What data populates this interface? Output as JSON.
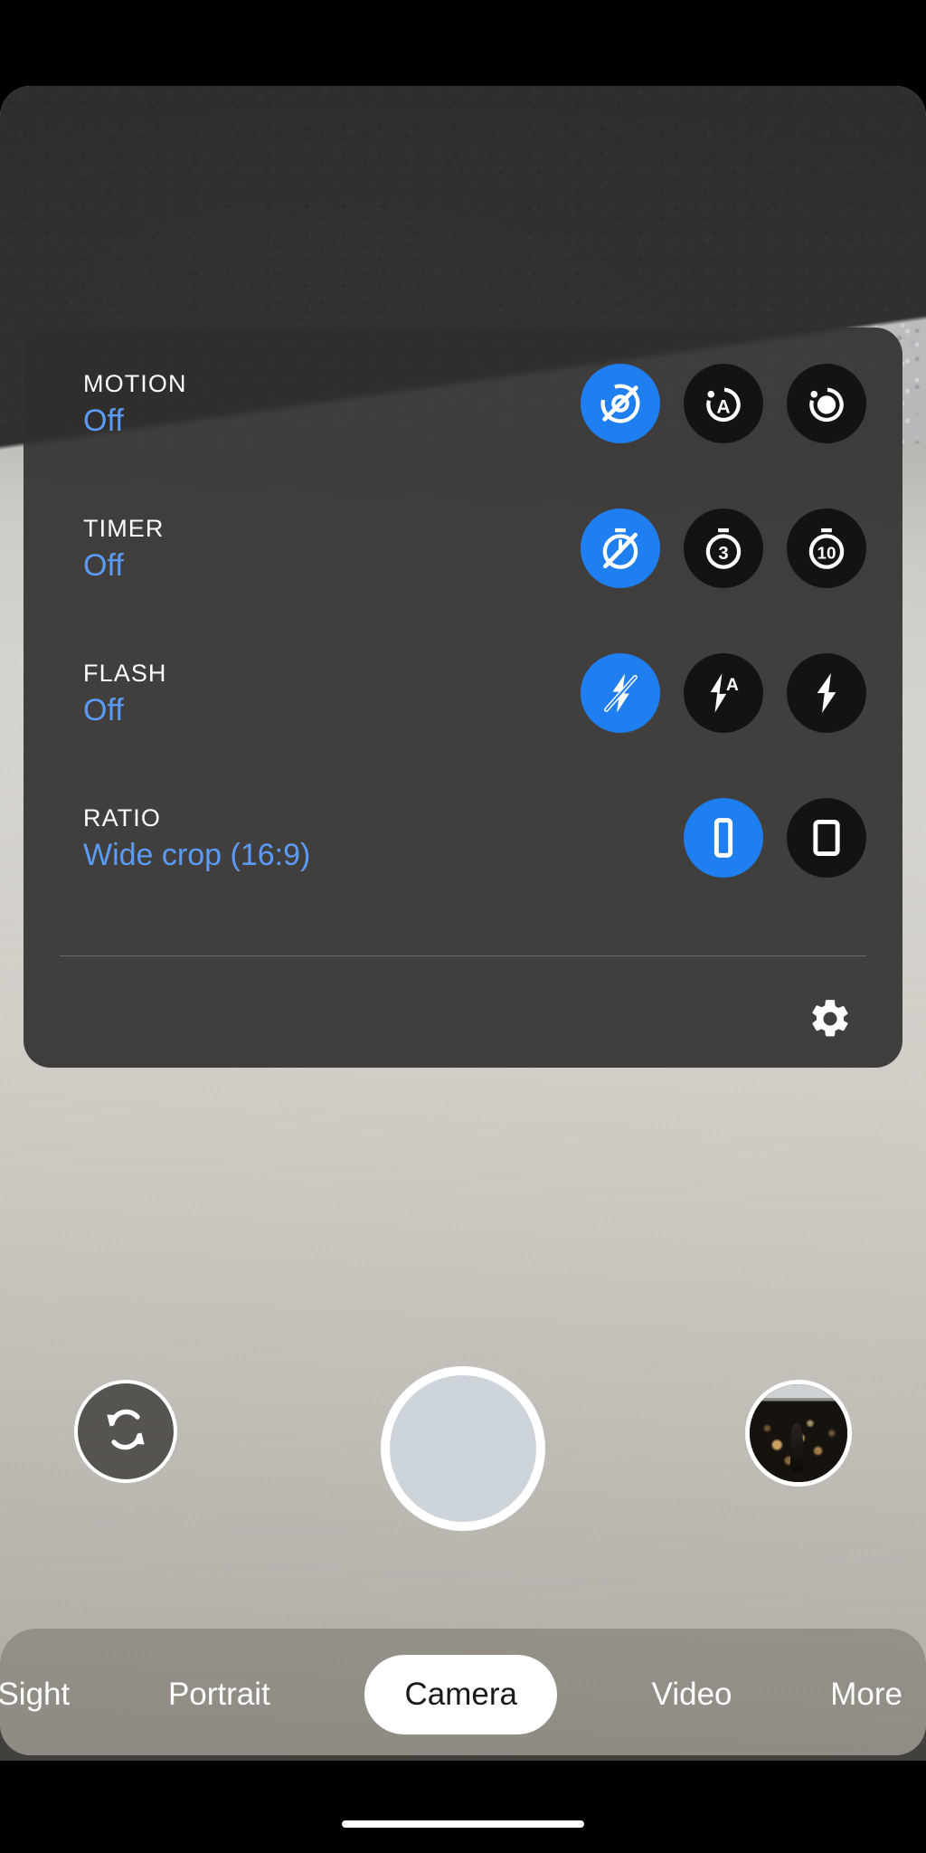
{
  "app": {
    "name": "Camera",
    "accent_blue": "#1f7ff0",
    "value_blue": "#5b9bf8",
    "panel_bg": "#302f2d",
    "option_bg": "#131313"
  },
  "settings_panel": {
    "rows": [
      {
        "title": "MOTION",
        "value": "Off",
        "options": [
          {
            "icon": "motion-off-icon",
            "label": "Motion off",
            "selected": true
          },
          {
            "icon": "motion-auto-icon",
            "label": "Motion auto",
            "selected": false
          },
          {
            "icon": "motion-on-icon",
            "label": "Motion on",
            "selected": false
          }
        ]
      },
      {
        "title": "TIMER",
        "value": "Off",
        "options": [
          {
            "icon": "timer-off-icon",
            "label": "Timer off",
            "selected": true
          },
          {
            "icon": "timer-3s-icon",
            "label": "3",
            "selected": false
          },
          {
            "icon": "timer-10s-icon",
            "label": "10",
            "selected": false
          }
        ]
      },
      {
        "title": "FLASH",
        "value": "Off",
        "options": [
          {
            "icon": "flash-off-icon",
            "label": "Flash off",
            "selected": true
          },
          {
            "icon": "flash-auto-icon",
            "label": "Flash auto",
            "selected": false
          },
          {
            "icon": "flash-on-icon",
            "label": "Flash on",
            "selected": false
          }
        ]
      },
      {
        "title": "RATIO",
        "value": "Wide crop (16:9)",
        "options": [
          {
            "icon": "ratio-wide-crop-icon",
            "label": "Wide crop (16:9)",
            "selected": true
          },
          {
            "icon": "ratio-full-icon",
            "label": "Full",
            "selected": false
          }
        ]
      }
    ],
    "settings_button": {
      "icon": "gear-icon",
      "label": "More settings"
    }
  },
  "bottom_controls": {
    "switch_camera": {
      "icon": "camera-switch-icon",
      "label": "Switch camera"
    },
    "shutter": {
      "icon": "shutter-icon",
      "label": "Take photo"
    },
    "gallery": {
      "icon": "gallery-thumbnail-icon",
      "label": "Gallery"
    }
  },
  "mode_tabs": {
    "items": [
      {
        "label": "t Sight",
        "active": false
      },
      {
        "label": "Portrait",
        "active": false
      },
      {
        "label": "Camera",
        "active": true
      },
      {
        "label": "Video",
        "active": false
      },
      {
        "label": "More",
        "active": false
      }
    ]
  }
}
